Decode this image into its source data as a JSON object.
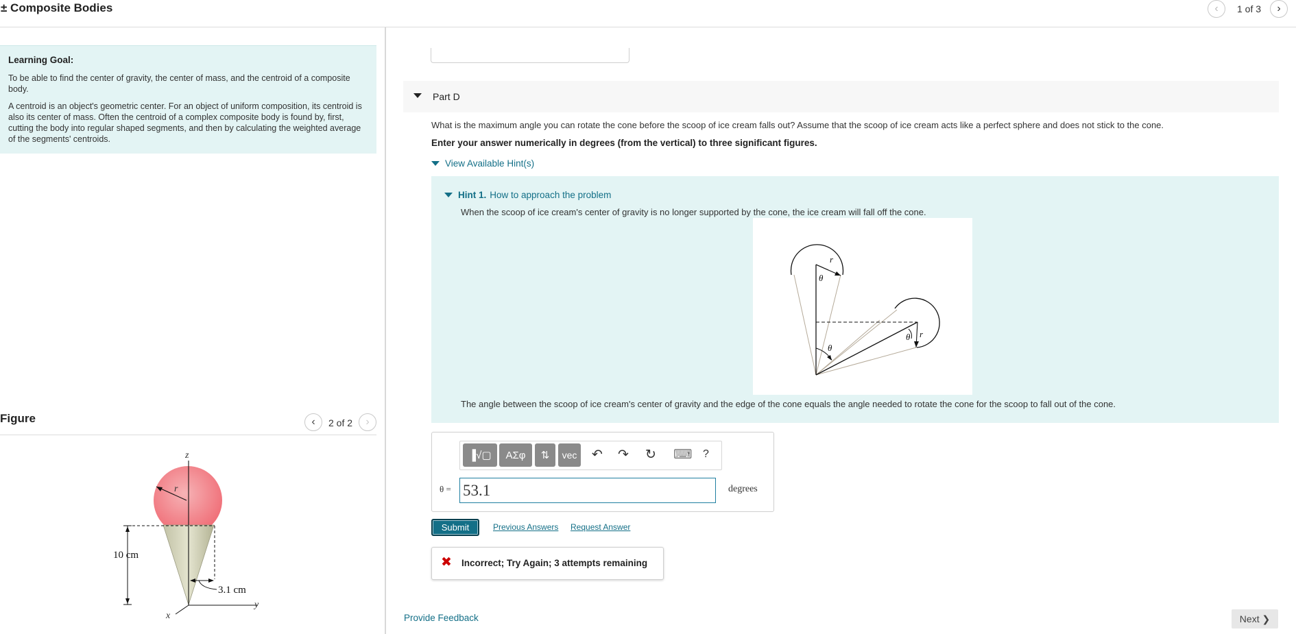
{
  "header": {
    "title": "± Composite Bodies",
    "counter": "1 of 3"
  },
  "learning_goal": {
    "heading": "Learning Goal:",
    "p1": "To be able to find the center of gravity, the center of mass, and the centroid of a composite body.",
    "p2": "A centroid is an object's geometric center. For an object of uniform composition, its centroid is also its center of mass. Often the centroid of a complex composite body is found by, first, cutting the body into regular shaped segments, and then by calculating the weighted average of the segments' centroids."
  },
  "figure": {
    "title": "Figure",
    "counter": "2 of 2",
    "labels": {
      "z": "z",
      "y": "y",
      "x": "x",
      "r": "r",
      "height": "10 cm",
      "width": "3.1 cm"
    }
  },
  "part": {
    "label": "Part D",
    "question": "What is the maximum angle you can rotate the cone before the scoop of ice cream falls out? Assume that the scoop of ice cream acts like a perfect sphere and does not stick to the cone.",
    "instruction": "Enter your answer numerically in degrees (from the vertical) to three significant figures.",
    "hints_toggle": "View Available Hint(s)"
  },
  "hint": {
    "number": "Hint 1.",
    "title": "How to approach the problem",
    "text1": "When the scoop of ice cream's center of gravity is no longer supported by the cone, the ice cream will fall off the cone.",
    "text2": "The angle between the scoop of ice cream's center of gravity and the edge of the cone equals the angle needed to rotate the cone for the scoop to fall out of the cone.",
    "diagram_labels": {
      "r": "r",
      "theta": "θ"
    }
  },
  "answer": {
    "toolbar": {
      "templates": "▐√▢",
      "greek": "AΣφ",
      "arrows": "⇅",
      "vec": "vec",
      "undo": "↶",
      "redo": "↷",
      "reset": "↻",
      "keyboard": "⌨",
      "help": "?"
    },
    "variable_label": "θ =",
    "value": "53.1",
    "unit": "degrees"
  },
  "actions": {
    "submit": "Submit",
    "previous_answers": "Previous Answers",
    "request_answer": "Request Answer"
  },
  "feedback": {
    "icon": "✖",
    "text": "Incorrect; Try Again; 3 attempts remaining"
  },
  "footer": {
    "provide_feedback": "Provide Feedback",
    "next": "Next ❯"
  },
  "colors": {
    "accent": "#136f87",
    "hint_bg": "#e3f4f4",
    "error": "#cc0000"
  }
}
